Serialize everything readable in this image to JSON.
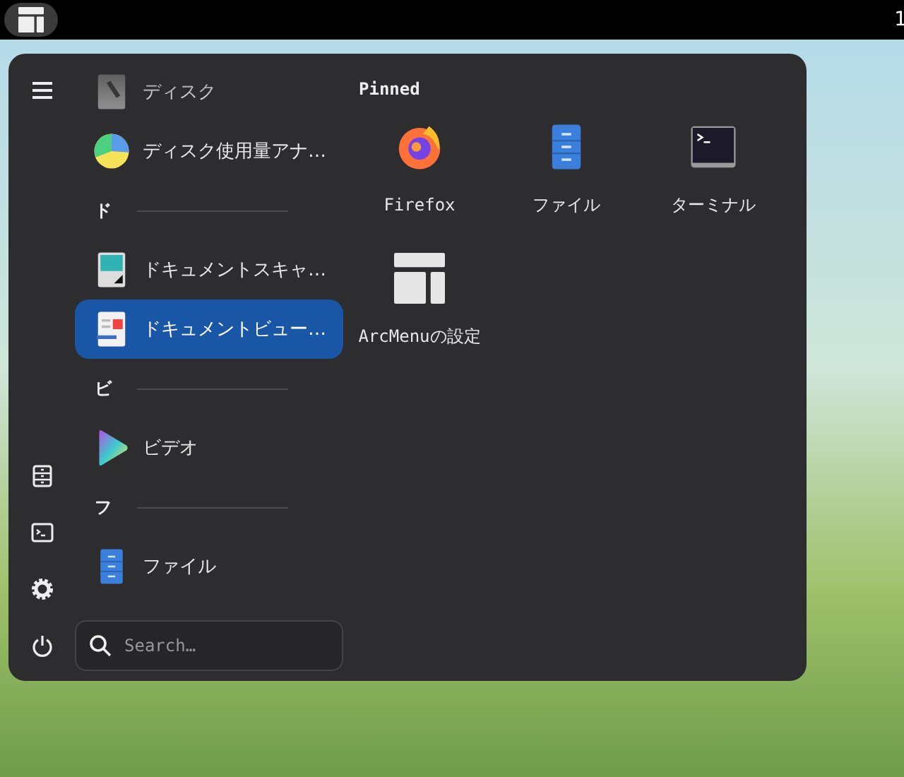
{
  "top_bar": {
    "clock": "1"
  },
  "sidebar": {
    "items": [
      {
        "kind": "app",
        "label": "ディスク",
        "selected": false
      },
      {
        "kind": "app",
        "label": "ディスク使用量アナ…",
        "selected": false
      },
      {
        "kind": "header",
        "label": "ド"
      },
      {
        "kind": "app",
        "label": "ドキュメントスキャ…",
        "selected": false
      },
      {
        "kind": "app",
        "label": "ドキュメントビュー…",
        "selected": true
      },
      {
        "kind": "header",
        "label": "ビ"
      },
      {
        "kind": "app",
        "label": "ビデオ",
        "selected": false
      },
      {
        "kind": "header",
        "label": "フ"
      },
      {
        "kind": "app",
        "label": "ファイル",
        "selected": false
      }
    ]
  },
  "search": {
    "placeholder": "Search…"
  },
  "pinned": {
    "title": "Pinned",
    "apps": [
      {
        "label": "Firefox"
      },
      {
        "label": "ファイル"
      },
      {
        "label": "ターミナル"
      },
      {
        "label": "ArcMenuの設定"
      }
    ]
  }
}
